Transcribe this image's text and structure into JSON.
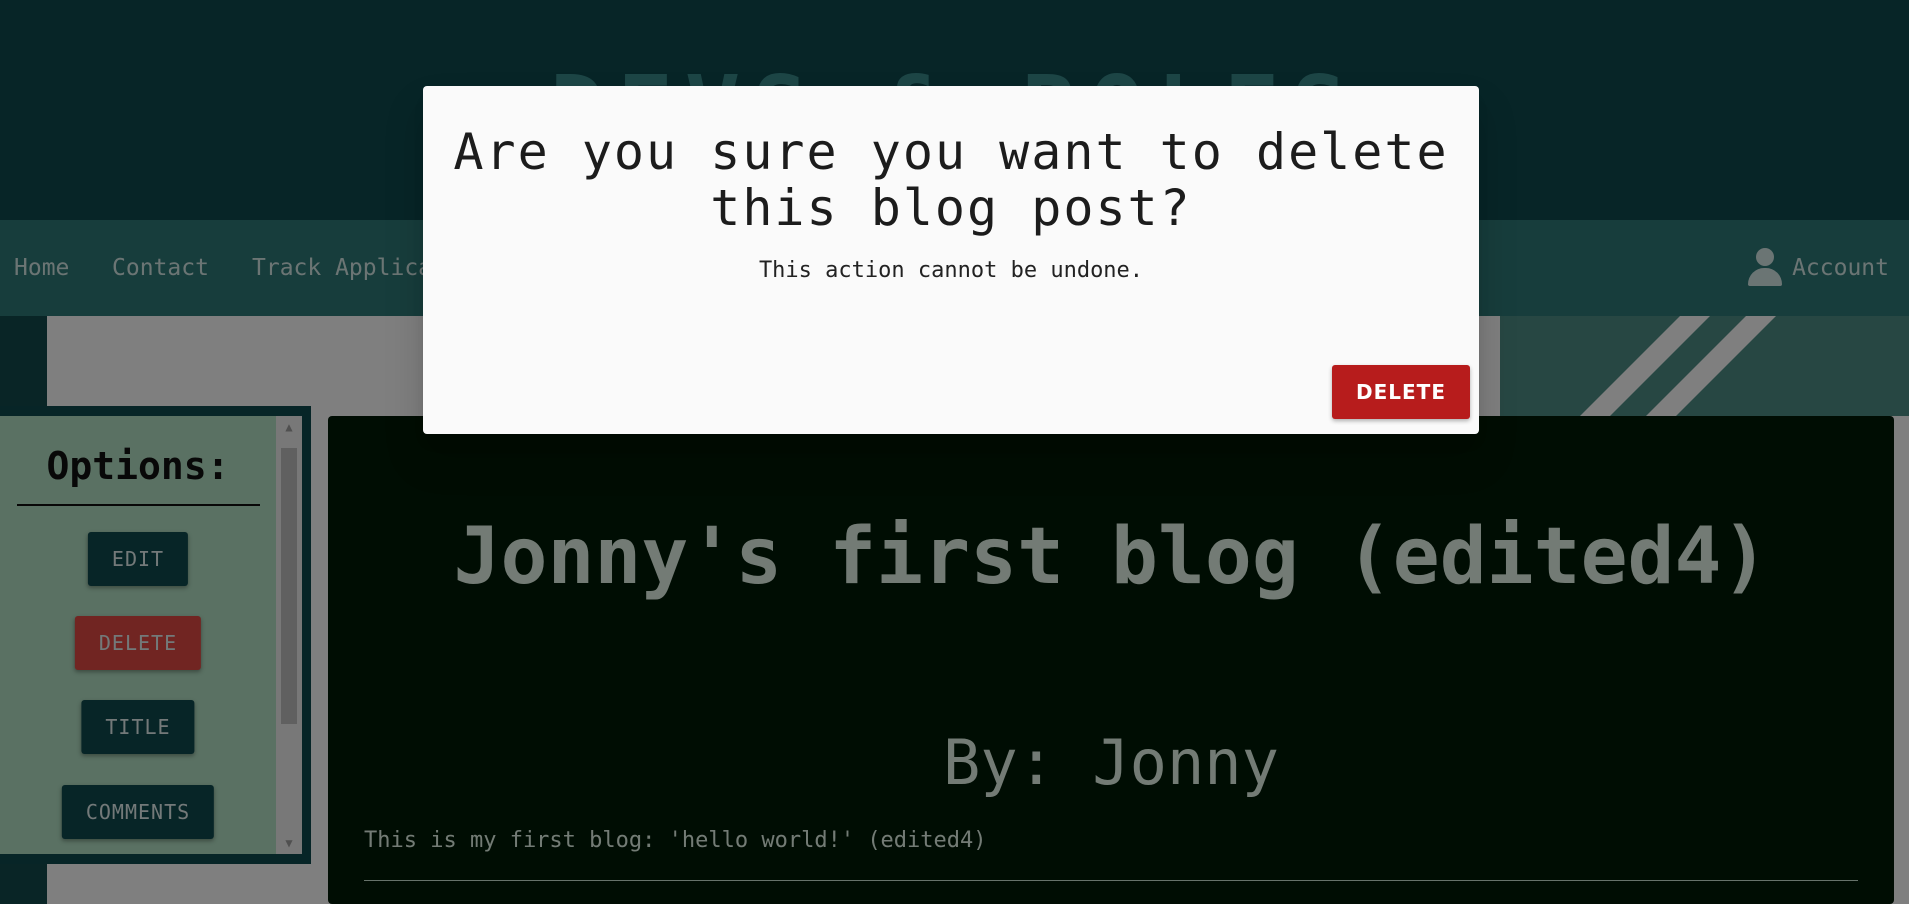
{
  "header": {
    "hero_title": "DEVS & ROLES"
  },
  "nav": {
    "links": [
      "Home",
      "Contact",
      "Track Applica"
    ],
    "account_label": "Account"
  },
  "options": {
    "title": "Options:",
    "buttons": [
      "EDIT",
      "DELETE",
      "TITLE",
      "COMMENTS"
    ]
  },
  "blog": {
    "title": "Jonny's first blog (edited4)",
    "author": "By: Jonny",
    "body": "This is my first blog: 'hello world!' (edited4)"
  },
  "dialog": {
    "title": "Are you sure you want to delete this blog post?",
    "text": "This action cannot be undone.",
    "delete_label": "DELETE"
  },
  "colors": {
    "delete_button": "#b71c1c",
    "options_delete": "#e24a45",
    "dark_teal": "#0f4a4f",
    "blog_background": "#001b07"
  }
}
